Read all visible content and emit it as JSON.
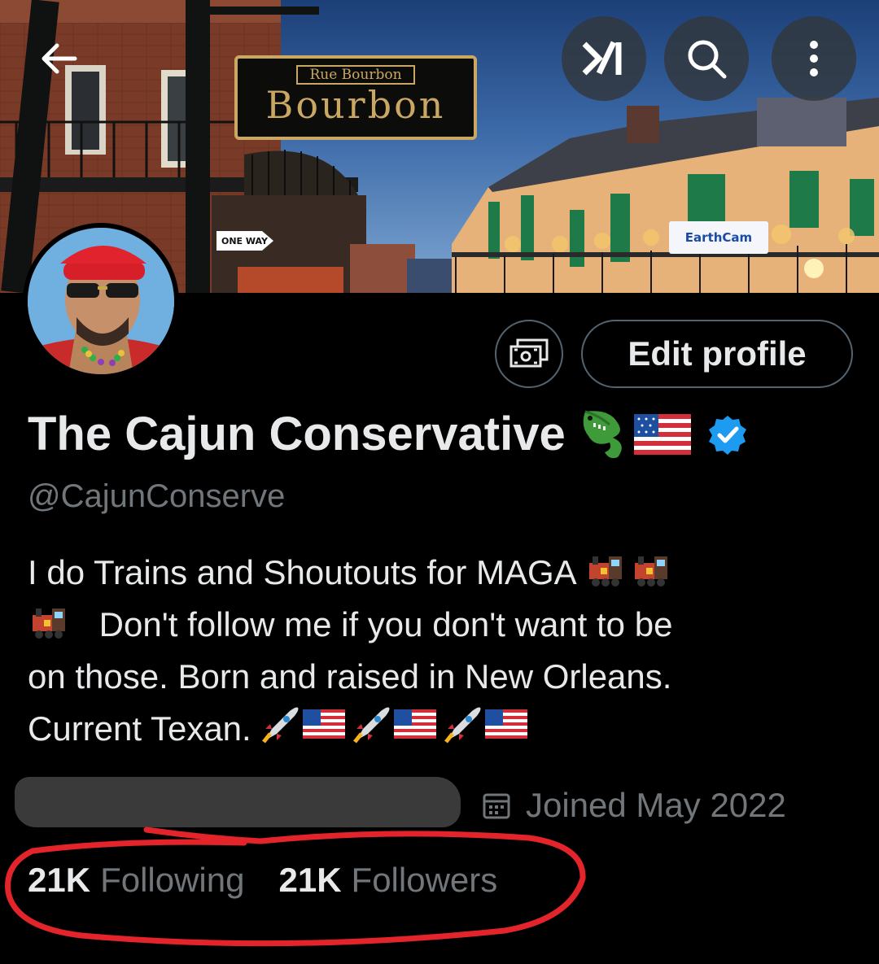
{
  "banner": {
    "sign_small": "Rue Bourbon",
    "sign_big": "Bourbon",
    "oneway": "ONE WAY",
    "earthcam": "EarthCam"
  },
  "nav": {
    "back_icon": "arrow-left-icon",
    "grok_icon": "grok-icon",
    "search_icon": "search-icon",
    "more_icon": "more-vertical-icon"
  },
  "profile": {
    "name": "The Cajun Conservative",
    "name_emoji": [
      "crocodile",
      "us-flag"
    ],
    "verified": true,
    "handle": "@CajunConserve",
    "bio_lines": [
      "I do Trains and Shoutouts for MAGA",
      "Don't follow me if you don't want to be",
      "on those. Born and raised in New Orleans.",
      "Current Texan."
    ],
    "joined": "Joined May 2022"
  },
  "actions": {
    "subscriptions_icon": "money-icon",
    "edit_label": "Edit profile"
  },
  "stats": {
    "following_count": "21K",
    "following_label": "Following",
    "followers_count": "21K",
    "followers_label": "Followers"
  },
  "colors": {
    "background": "#000000",
    "text": "#e7e9ea",
    "muted": "#71767b",
    "verified": "#1d9bf0",
    "annotation": "#e3242b"
  }
}
